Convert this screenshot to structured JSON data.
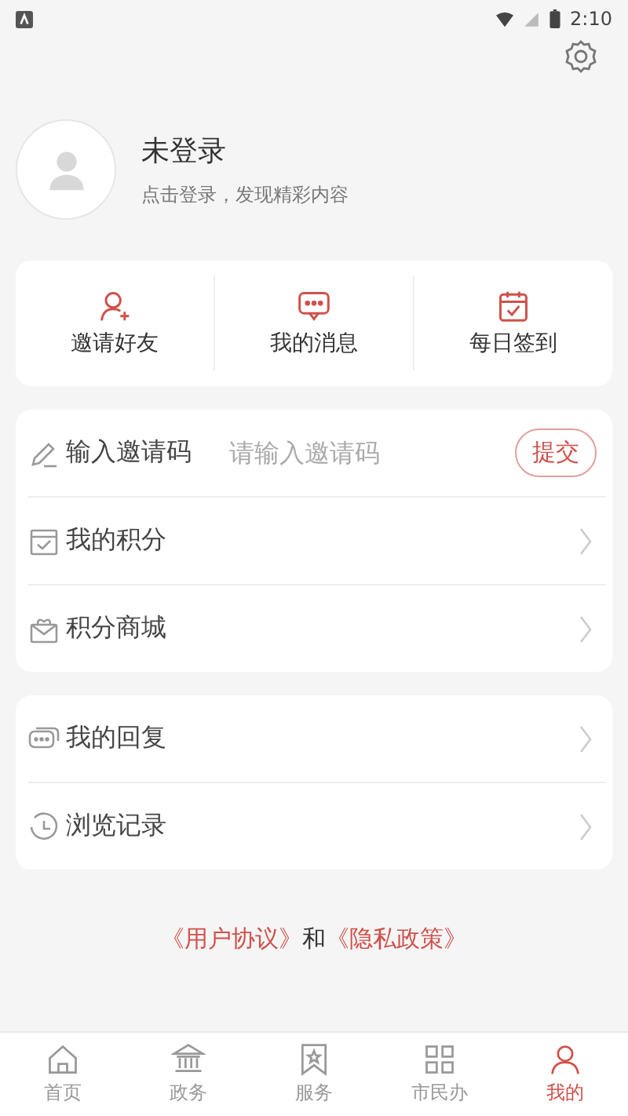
{
  "status_bar": {
    "time": "2:10"
  },
  "profile": {
    "name": "未登录",
    "subtitle": "点击登录，发现精彩内容"
  },
  "quick_actions": [
    {
      "kind": "invite",
      "label": "邀请好友"
    },
    {
      "kind": "message",
      "label": "我的消息"
    },
    {
      "kind": "checkin",
      "label": "每日签到"
    }
  ],
  "menu_groups": [
    [
      {
        "kind": "invite-code",
        "label": "输入邀请码",
        "placeholder": "请输入邀请码",
        "button": "提交"
      },
      {
        "kind": "points",
        "label": "我的积分"
      },
      {
        "kind": "mall",
        "label": "积分商城"
      }
    ],
    [
      {
        "kind": "replies",
        "label": "我的回复"
      },
      {
        "kind": "history",
        "label": "浏览记录"
      }
    ]
  ],
  "agreement": {
    "links": [
      "《用户协议》",
      "《隐私政策》"
    ],
    "joiner": "和"
  },
  "tabs": [
    {
      "kind": "home",
      "label": "首页",
      "selected": false
    },
    {
      "kind": "affairs",
      "label": "政务",
      "selected": false
    },
    {
      "kind": "service",
      "label": "服务",
      "selected": false
    },
    {
      "kind": "citizen",
      "label": "市民办",
      "selected": false
    },
    {
      "kind": "mine",
      "label": "我的",
      "selected": true
    }
  ]
}
